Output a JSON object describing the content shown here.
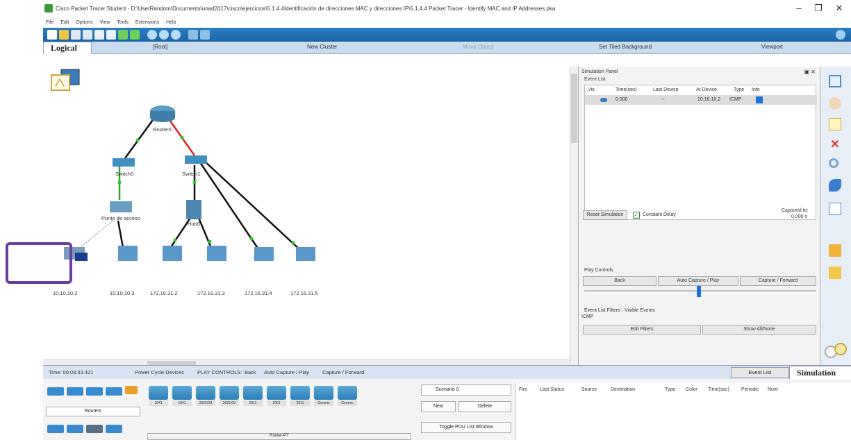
{
  "window": {
    "title": "Cisco Packet Tracer Student - D:\\UserRandom\\Documents\\unad2017\\cisco\\ejercicios\\5.1.4.4Identificación de direcciones MAC y direcciones IP\\5.1.4.4 Packet Tracer - Identify MAC and IP Addresses.pka",
    "minimize": "–",
    "maximize": "❐",
    "close": "✕"
  },
  "menu": [
    "File",
    "Edit",
    "Options",
    "View",
    "Tools",
    "Extensions",
    "Help"
  ],
  "workbar": {
    "logical_tab": "Logical",
    "root": "[Root]",
    "new_cluster": "New Cluster",
    "move_object": "Move Object",
    "set_tiled_background": "Set Tiled Background",
    "viewport": "Viewport"
  },
  "topology": {
    "router_label": "Router0",
    "switch0_label": "Switch0",
    "switch1_label": "Switch1",
    "ap_label": "Punto de acceso",
    "hub_label": "Hub0",
    "hosts": [
      "10.10.10.2",
      "10.10.10.3",
      "172.16.31.2",
      "172.16.31.3",
      "172.16.31.4",
      "172.16.31.5"
    ]
  },
  "sim_panel": {
    "title": "Simulation Panel",
    "event_list_label": "Event List",
    "headers": [
      "Vis.",
      "Time(sec)",
      "Last Device",
      "At Device",
      "Type",
      "Info"
    ],
    "row": {
      "time": "0.000",
      "last_device": "--",
      "at_device": "10.10.10.2",
      "type": "ICMP"
    },
    "reset_simulation": "Reset Simulation",
    "constant_delay": "Constant Delay",
    "captured_to_label": "Captured to:",
    "captured_to_value": "0.000 s",
    "play_controls": "Play Controls",
    "back": "Back",
    "auto_capture": "Auto Capture / Play",
    "capture_forward": "Capture / Forward",
    "filters_label": "Event List Filters - Visible Events",
    "filter_value": "ICMP",
    "edit_filters": "Edit Filters",
    "show_all": "Show All/None"
  },
  "statusbar": {
    "time": "Time: 00:03:33.421",
    "power_cycle": "Power Cycle Devices",
    "play_controls": "PLAY CONTROLS:",
    "back": "Back",
    "auto": "Auto Capture / Play",
    "capture_forward": "Capture / Forward",
    "event_list": "Event List",
    "simulation": "Simulation"
  },
  "bottom": {
    "category": "Routers",
    "router_models": [
      "1841",
      "1941",
      "2620XM",
      "2621XM",
      "2811",
      "2901",
      "2911",
      "Generic",
      "Generic"
    ],
    "router_type": "Router-PT",
    "scenario": "Scenario 0",
    "new": "New",
    "delete": "Delete",
    "toggle_pdu": "Toggle PDU List Window",
    "pdu_headers": [
      "Fire",
      "Last Status",
      "Source",
      "Destination",
      "Type",
      "Color",
      "Time(sec)",
      "Periodic",
      "Num"
    ]
  },
  "colors": {
    "toolbar": "#2a7dc4",
    "highlight": "#6a3ea1",
    "link_green": "#22aa22",
    "link_red": "#dd2222"
  }
}
